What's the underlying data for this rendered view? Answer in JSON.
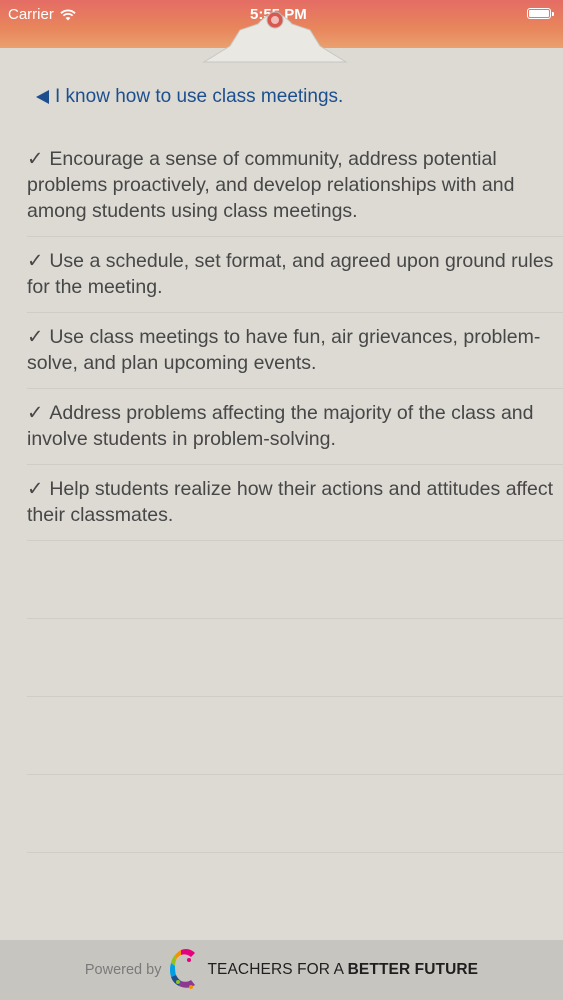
{
  "status_bar": {
    "carrier": "Carrier",
    "time": "5:55 PM"
  },
  "back_link": {
    "label": "I know how to use class meetings."
  },
  "items": [
    {
      "check": "✓",
      "text": "Encourage a sense of community, address potential problems proactively, and develop relationships with and among students using class meetings."
    },
    {
      "check": "✓",
      "text": "Use a schedule, set format, and agreed upon ground rules for the meeting."
    },
    {
      "check": "✓",
      "text": "Use class meetings to have fun, air grievances, problem-solve, and plan upcoming events."
    },
    {
      "check": "✓",
      "text": "Address problems affecting the majority of the class and involve students in problem-solving."
    },
    {
      "check": "✓",
      "text": "Help students realize how their actions and attitudes affect their classmates."
    }
  ],
  "footer": {
    "powered_by": "Powered by",
    "brand_prefix": "TEACHERS FOR A ",
    "brand_bold": "BETTER FUTURE"
  },
  "colors": {
    "top_band": "#e46c64",
    "background": "#dcdad3",
    "link": "#1d4f8e",
    "footer": "#c7c5c0"
  },
  "icons": [
    "wifi-icon",
    "battery-icon",
    "clipboard-clip-icon",
    "back-arrow-icon",
    "logo-icon"
  ]
}
